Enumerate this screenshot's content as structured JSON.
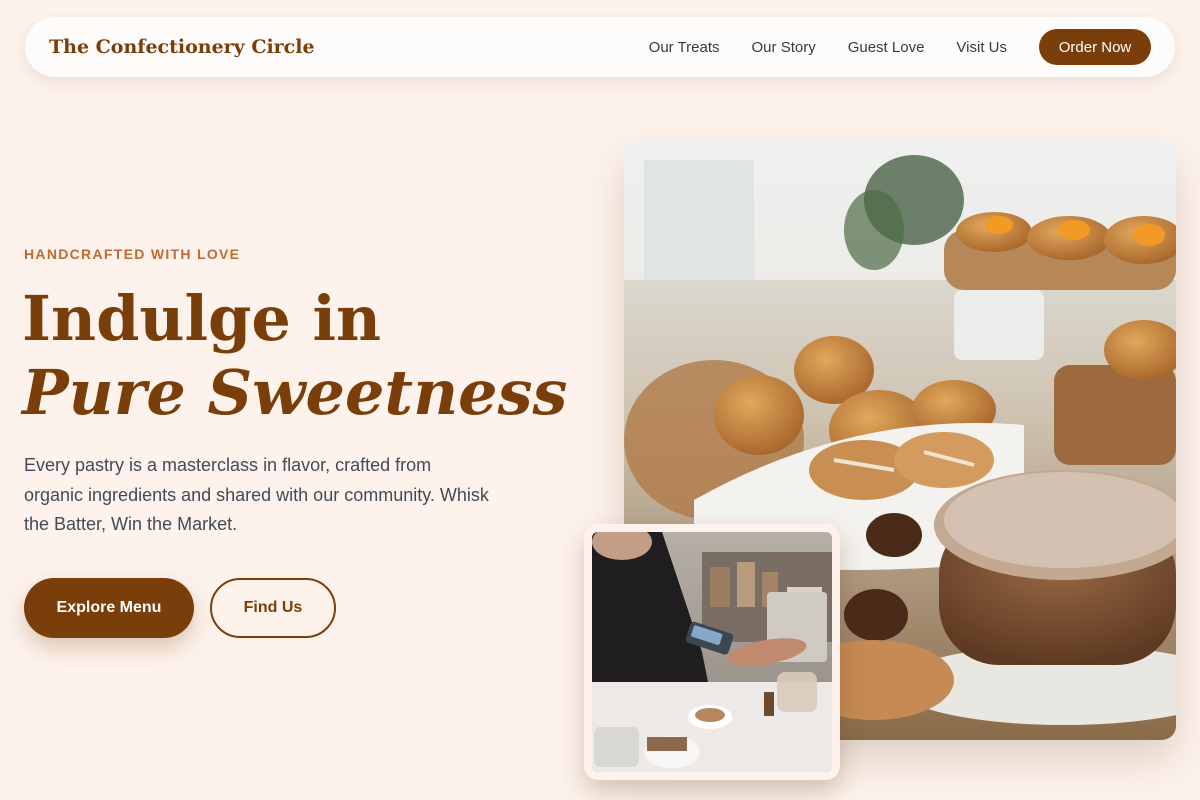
{
  "nav": {
    "brand": "The Confectionery Circle",
    "links": [
      "Our Treats",
      "Our Story",
      "Guest Love",
      "Visit Us"
    ],
    "cta": "Order Now"
  },
  "hero": {
    "eyebrow": "HANDCRAFTED WITH LOVE",
    "headline_line1": "Indulge in",
    "headline_line2": "Pure Sweetness",
    "description": "Every pastry is a masterclass in flavor, crafted from organic ingredients and shared with our community. Whisk the Batter, Win the Market.",
    "primary_button": "Explore Menu",
    "secondary_button": "Find Us"
  },
  "images": {
    "main": "pastry-display-photo",
    "inset": "cafe-counter-payment-photo"
  },
  "colors": {
    "background": "#fdf3ec",
    "brand": "#7a3e0a",
    "accent": "#c06a32"
  }
}
